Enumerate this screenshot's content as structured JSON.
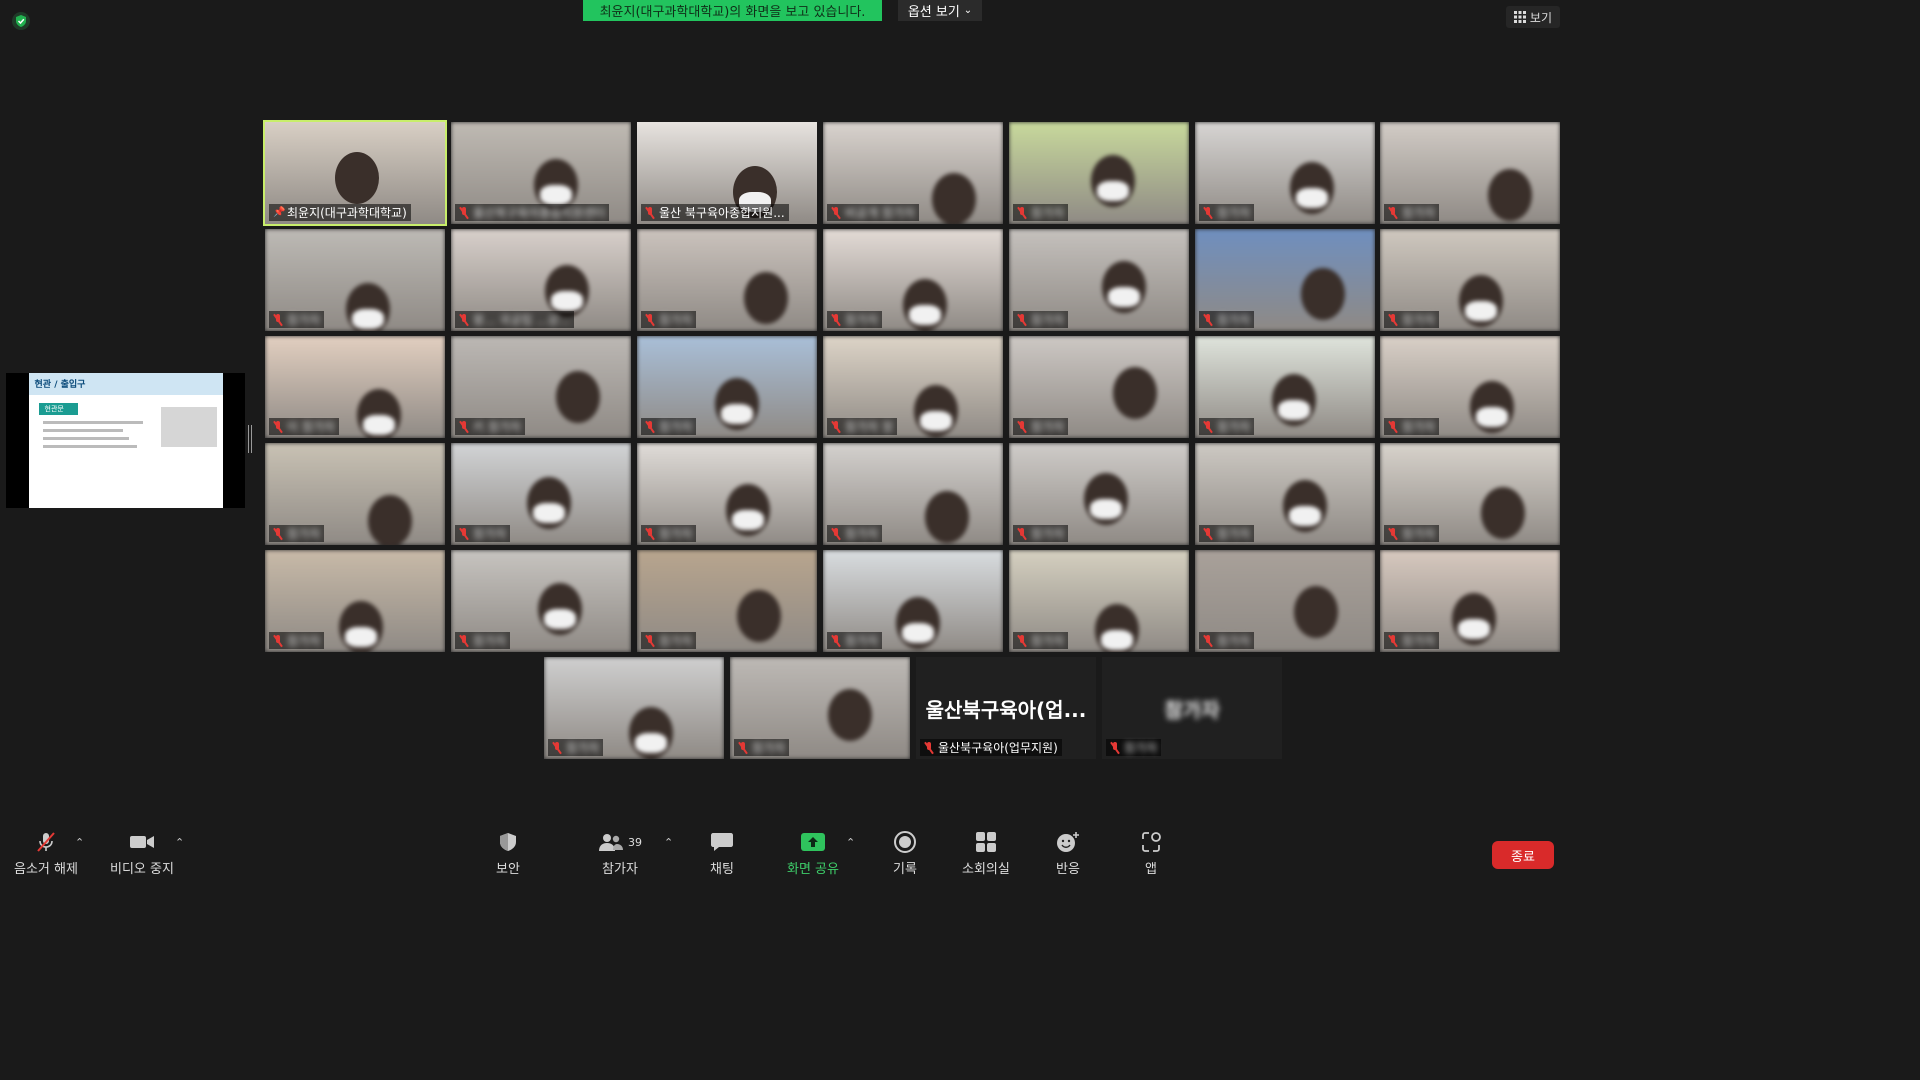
{
  "banner": {
    "viewing_text": "최윤지(대구과학대학교)의 화면을 보고 있습니다.",
    "view_options_label": "옵션 보기",
    "view_label": "보기"
  },
  "slide": {
    "header": "현관 / 출입구",
    "tag": "현관문"
  },
  "tiles": [
    {
      "name": "최윤지(대구과학대학교)",
      "blur": false,
      "pinned": true,
      "color": "#d8cfc4"
    },
    {
      "name": "울산북구육아종합지원센터",
      "blur": true,
      "color": "#bfbab3"
    },
    {
      "name": "울산 북구육아종합지원...",
      "blur": false,
      "color": "#e7e3df"
    },
    {
      "name": "비공개 참가자",
      "blur": true,
      "color": "#d9d3ce"
    },
    {
      "name": "참가자",
      "blur": true,
      "color": "#c8d99c"
    },
    {
      "name": "참가자",
      "blur": true,
      "color": "#d7d5d3"
    },
    {
      "name": "참가자",
      "blur": true,
      "color": "#d2ccc6"
    },
    {
      "name": "참가자",
      "blur": true,
      "color": "#bdbab5"
    },
    {
      "name": "왕... 국공립 ...상...",
      "blur": true,
      "color": "#d8d0cb"
    },
    {
      "name": "참가자",
      "blur": true,
      "color": "#cbc3bd"
    },
    {
      "name": "참가자",
      "blur": true,
      "color": "#e3dbd6"
    },
    {
      "name": "참가자",
      "blur": true,
      "color": "#c5c1bd"
    },
    {
      "name": "참가자",
      "blur": true,
      "color": "#6f8fbf"
    },
    {
      "name": "참가자",
      "blur": true,
      "color": "#cfc8bf"
    },
    {
      "name": "이 참가자",
      "blur": true,
      "color": "#e2cfc0"
    },
    {
      "name": "키 참가자",
      "blur": true,
      "color": "#bcb8b4"
    },
    {
      "name": "참가자",
      "blur": true,
      "color": "#a9bfd8"
    },
    {
      "name": "참가자 정",
      "blur": true,
      "color": "#ddd4c7"
    },
    {
      "name": "참가자",
      "blur": true,
      "color": "#cdc8c4"
    },
    {
      "name": "참가자",
      "blur": true,
      "color": "#dfe4dc"
    },
    {
      "name": "참가자",
      "blur": true,
      "color": "#d9d0c7"
    },
    {
      "name": "참가자",
      "blur": true,
      "color": "#c9c2b4"
    },
    {
      "name": "참가자",
      "blur": true,
      "color": "#d2d4d6"
    },
    {
      "name": "참가자",
      "blur": true,
      "color": "#e0dcd8"
    },
    {
      "name": "참가자",
      "blur": true,
      "color": "#d4d1ce"
    },
    {
      "name": "참가자",
      "blur": true,
      "color": "#cfccc9"
    },
    {
      "name": "참가자",
      "blur": true,
      "color": "#cdc9c3"
    },
    {
      "name": "참가자",
      "blur": true,
      "color": "#d8d3cc"
    },
    {
      "name": "참가자",
      "blur": true,
      "color": "#c8baa8"
    },
    {
      "name": "참가자",
      "blur": true,
      "color": "#c7c4c0"
    },
    {
      "name": "참가자",
      "blur": true,
      "color": "#b8a58e"
    },
    {
      "name": "참가자",
      "blur": true,
      "color": "#d9dde0"
    },
    {
      "name": "참가자",
      "blur": true,
      "color": "#d5d0c0"
    },
    {
      "name": "참가자",
      "blur": true,
      "color": "#a9a19a"
    },
    {
      "name": "참가자",
      "blur": true,
      "color": "#d7c9bf"
    },
    {
      "name": "참가자",
      "blur": true,
      "color": "#cfcfcf"
    },
    {
      "name": "참가자",
      "blur": true,
      "color": "#bdb9b5"
    },
    {
      "name": "울산북구육아(업무지원)",
      "blur": false,
      "name_only": "울산북구육아(업...",
      "color": "#262626"
    },
    {
      "name": "참가자",
      "blur": true,
      "name_only": "참가자",
      "color": "#262626"
    }
  ],
  "toolbar": {
    "unmute": "음소거 해제",
    "stop_video": "비디오 중지",
    "security": "보안",
    "participants": "참가자",
    "participants_count": "39",
    "chat": "채팅",
    "share": "화면 공유",
    "record": "기록",
    "breakout": "소회의실",
    "reactions": "반응",
    "apps": "앱",
    "end": "종료"
  }
}
